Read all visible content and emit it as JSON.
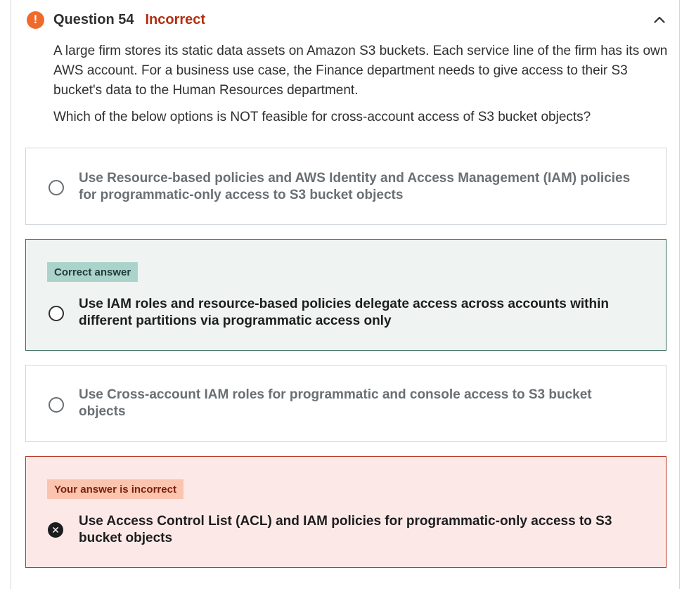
{
  "question": {
    "number_label": "Question 54",
    "status": "Incorrect",
    "status_color": "#b32d0f",
    "prompt": "A large firm stores its static data assets on Amazon S3 buckets. Each service line of the firm has its own AWS account. For a business use case, the Finance department needs to give access to their S3 bucket's data to the Human Resources department.",
    "ask": "Which of the below options is NOT feasible for cross-account access of S3 bucket objects?"
  },
  "icons": {
    "alert": "exclamation-circle-icon",
    "collapse": "chevron-up-icon",
    "radio": "radio-empty-icon",
    "wrong": "x-circle-icon"
  },
  "options": [
    {
      "text": "Use Resource-based policies and AWS Identity and Access Management (IAM) policies for programmatic-only access to S3 bucket objects"
    },
    {
      "badge": "Correct answer",
      "text": "Use IAM roles and resource-based policies delegate access across accounts within different partitions via programmatic access only"
    },
    {
      "text": "Use Cross-account IAM roles for programmatic and console access to S3 bucket objects"
    },
    {
      "badge": "Your answer is incorrect",
      "text": "Use Access Control List (ACL) and IAM policies for programmatic-only access to S3 bucket objects"
    }
  ],
  "colors": {
    "alert_icon": "#f06a2b",
    "correct_bg": "#eff4f2",
    "correct_badge": "#acd2cc",
    "incorrect_bg": "#fce9e7",
    "incorrect_badge": "#fbc4ae"
  }
}
